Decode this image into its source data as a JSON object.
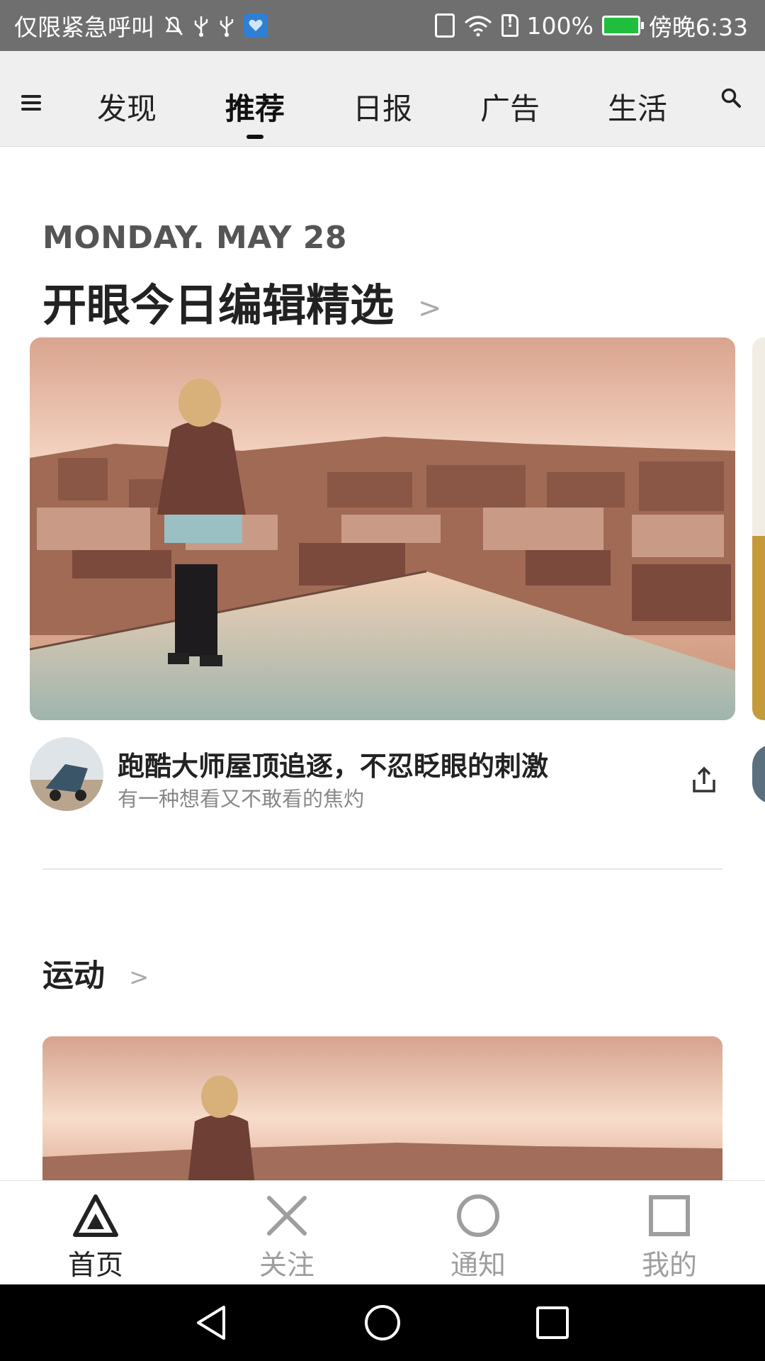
{
  "status_bar": {
    "carrier_text": "仅限紧急呼叫",
    "left_icons": [
      "muted-bell-icon",
      "usb-icon",
      "usb-icon",
      "wechat-icon"
    ],
    "battery_percent": "100%",
    "time": "傍晚6:33",
    "right_icons": [
      "vibrate-icon",
      "wifi-icon",
      "sd-card-icon",
      "battery-icon"
    ]
  },
  "top_nav": {
    "tabs": [
      {
        "label": "发现"
      },
      {
        "label": "推荐"
      },
      {
        "label": "日报"
      },
      {
        "label": "广告"
      },
      {
        "label": "生活"
      }
    ],
    "active_tab": "推荐"
  },
  "featured": {
    "date": "MONDAY. MAY 28",
    "title": "开眼今日编辑精选",
    "card": {
      "title": "跑酷大师屋顶追逐，不忍眨眼的刺激",
      "subtitle": "有一种想看又不敢看的焦灼"
    }
  },
  "section2": {
    "title": "运动"
  },
  "bottom_nav": {
    "items": [
      {
        "label": "首页",
        "icon": "triangle-icon"
      },
      {
        "label": "关注",
        "icon": "cross-icon"
      },
      {
        "label": "通知",
        "icon": "circle-icon"
      },
      {
        "label": "我的",
        "icon": "square-icon"
      }
    ],
    "active": "首页"
  },
  "colors": {
    "status_bar_bg": "#6f6f6f",
    "top_nav_bg": "#efefef",
    "text_dark": "#222222",
    "text_muted": "#888888"
  }
}
